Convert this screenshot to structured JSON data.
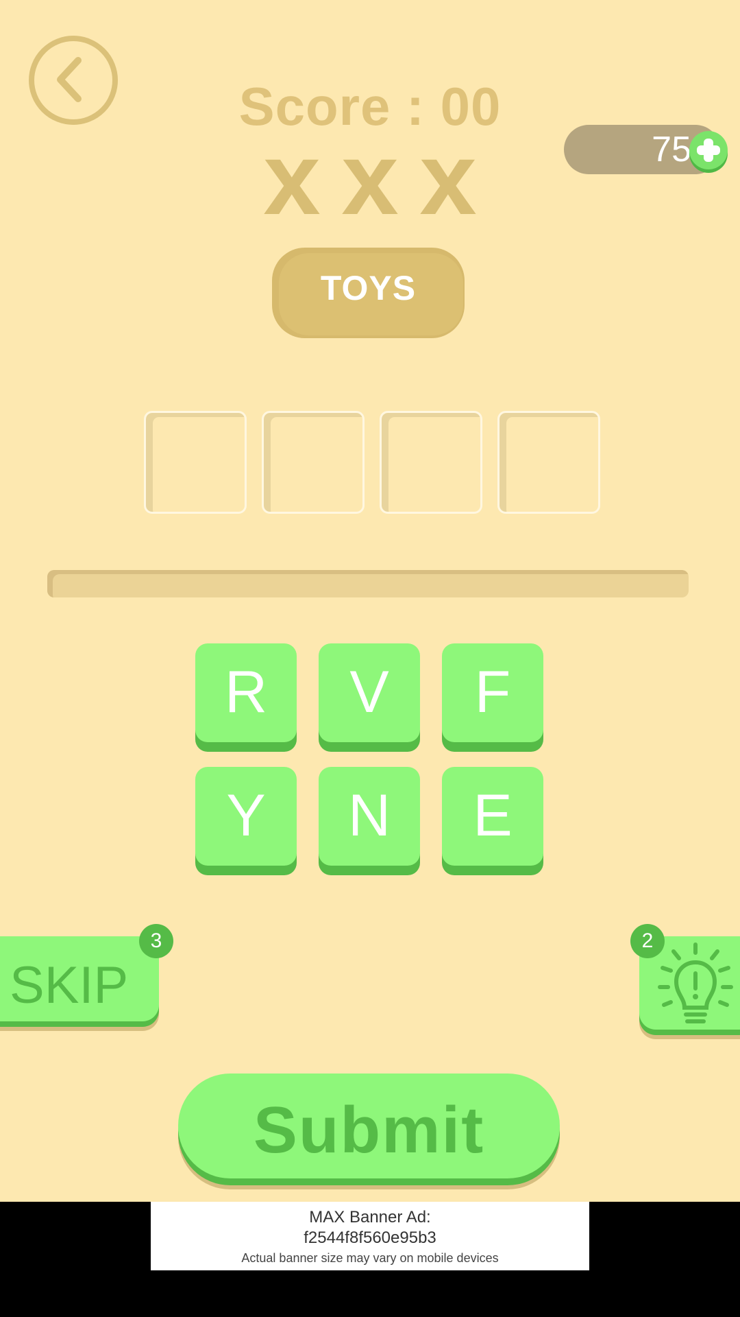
{
  "header": {
    "back_icon": "chevron-left-icon",
    "score_text": "Score : 00",
    "strikes": [
      "x",
      "x",
      "x"
    ],
    "coins": "75",
    "coin_add_icon": "plus-icon"
  },
  "category": {
    "label": "TOYS"
  },
  "answer": {
    "slots": [
      "",
      "",
      "",
      ""
    ]
  },
  "progress": {
    "fraction": 0
  },
  "tiles": [
    "R",
    "V",
    "F",
    "Y",
    "N",
    "E"
  ],
  "actions": {
    "skip_label": "SKIP",
    "skip_count": "3",
    "hint_icon": "lightbulb-icon",
    "hint_count": "2",
    "submit_label": "Submit"
  },
  "ad": {
    "title_line1": "MAX Banner Ad:",
    "title_line2": "f2544f8f560e95b3",
    "note": "Actual banner size may vary on mobile devices"
  },
  "colors": {
    "background": "#fde8b0",
    "muted_gold": "#dcc072",
    "tile_green": "#8ef77a",
    "dark_green": "#55bb47",
    "coin_pill": "#b5a57f"
  }
}
